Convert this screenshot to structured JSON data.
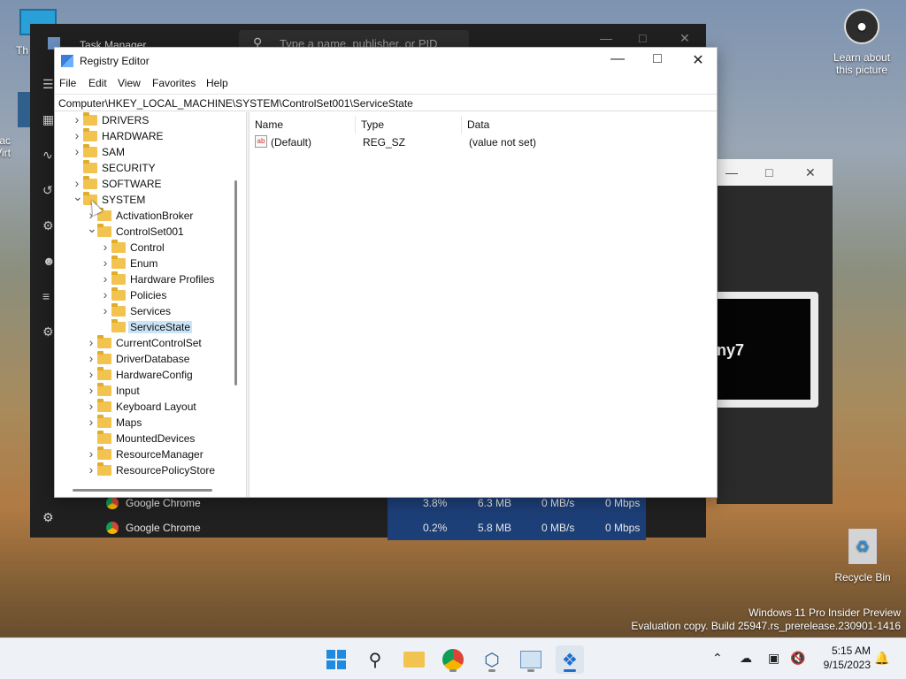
{
  "desktop": {
    "learn_about_label": "Learn about this picture",
    "recycle_bin_label": "Recycle Bin",
    "top_left_label": "Th",
    "side_label_1": "Orac",
    "side_label_2": "Virt",
    "watermark_line1": "Windows 11 Pro Insider Preview",
    "watermark_line2": "Evaluation copy. Build 25947.rs_prerelease.230901-1416"
  },
  "task_manager": {
    "title": "Task Manager",
    "search_placeholder": "Type a name, publisher, or PID",
    "rows": [
      {
        "name": "Google Chrome",
        "cpu": "3.8%",
        "memory": "6.3 MB",
        "disk": "0 MB/s",
        "network": "0 Mbps"
      },
      {
        "name": "Google Chrome",
        "cpu": "0.2%",
        "memory": "5.8 MB",
        "disk": "0 MB/s",
        "network": "0 Mbps"
      }
    ]
  },
  "vm_window": {
    "partial_text": "ny7"
  },
  "registry_editor": {
    "title": "Registry Editor",
    "menu": [
      "File",
      "Edit",
      "View",
      "Favorites",
      "Help"
    ],
    "address": "Computer\\HKEY_LOCAL_MACHINE\\SYSTEM\\ControlSet001\\ServiceState",
    "tree": [
      {
        "label": "DRIVERS",
        "expander": "collapsed"
      },
      {
        "label": "HARDWARE",
        "expander": "collapsed"
      },
      {
        "label": "SAM",
        "expander": "collapsed"
      },
      {
        "label": "SECURITY",
        "expander": "none"
      },
      {
        "label": "SOFTWARE",
        "expander": "collapsed"
      },
      {
        "label": "SYSTEM",
        "expander": "expanded"
      },
      {
        "label": "ActivationBroker",
        "expander": "collapsed"
      },
      {
        "label": "ControlSet001",
        "expander": "expanded"
      },
      {
        "label": "Control",
        "expander": "collapsed"
      },
      {
        "label": "Enum",
        "expander": "collapsed"
      },
      {
        "label": "Hardware Profiles",
        "expander": "collapsed"
      },
      {
        "label": "Policies",
        "expander": "collapsed"
      },
      {
        "label": "Services",
        "expander": "collapsed"
      },
      {
        "label": "ServiceState",
        "expander": "none",
        "selected": true
      },
      {
        "label": "CurrentControlSet",
        "expander": "collapsed"
      },
      {
        "label": "DriverDatabase",
        "expander": "collapsed"
      },
      {
        "label": "HardwareConfig",
        "expander": "collapsed"
      },
      {
        "label": "Input",
        "expander": "collapsed"
      },
      {
        "label": "Keyboard Layout",
        "expander": "collapsed"
      },
      {
        "label": "Maps",
        "expander": "collapsed"
      },
      {
        "label": "MountedDevices",
        "expander": "none"
      },
      {
        "label": "ResourceManager",
        "expander": "collapsed"
      },
      {
        "label": "ResourcePolicyStore",
        "expander": "collapsed"
      }
    ],
    "columns": {
      "name": "Name",
      "type": "Type",
      "data": "Data"
    },
    "values": [
      {
        "name": "(Default)",
        "type": "REG_SZ",
        "data": "(value not set)",
        "icon": "ab"
      }
    ]
  },
  "taskbar": {
    "time": "5:15 AM",
    "date": "9/15/2023",
    "apps": [
      "start-icon",
      "search-icon",
      "file-explorer-icon",
      "chrome-icon",
      "virtualbox-icon",
      "task-manager-icon",
      "registry-editor-icon"
    ]
  },
  "colors": {
    "selection": "#cce4f7",
    "folder": "#f2c44f",
    "task_manager_bg": "#202020",
    "cpu_highlight": "#1d3f78"
  }
}
